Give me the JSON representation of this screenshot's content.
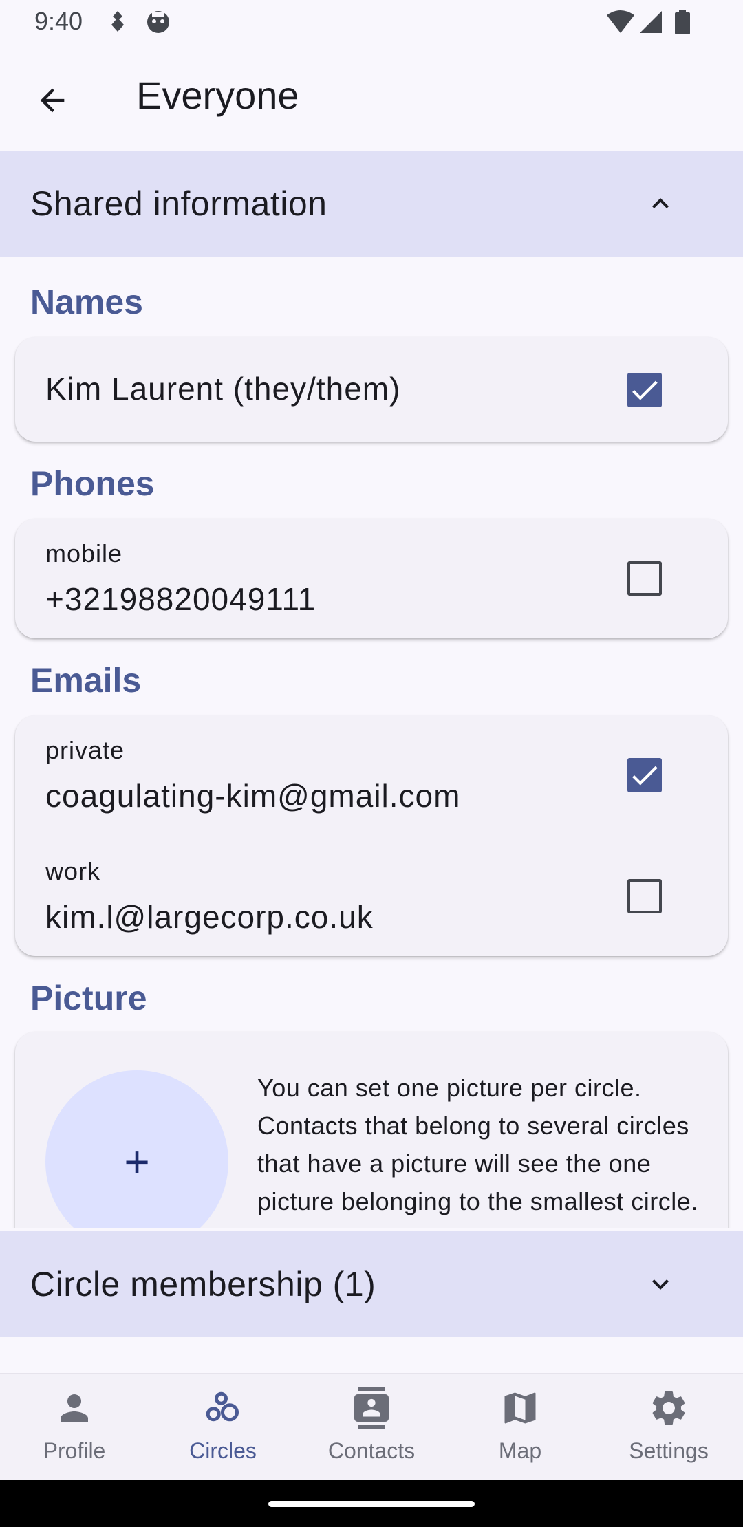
{
  "status": {
    "time": "9:40"
  },
  "app_bar": {
    "title": "Everyone"
  },
  "shared_section": {
    "label": "Shared information"
  },
  "names": {
    "title": "Names",
    "items": [
      {
        "value": "Kim Laurent (they/them)",
        "checked": true
      }
    ]
  },
  "phones": {
    "title": "Phones",
    "items": [
      {
        "label": "mobile",
        "value": "+32198820049111",
        "checked": false
      }
    ]
  },
  "emails": {
    "title": "Emails",
    "items": [
      {
        "label": "private",
        "value": "coagulating-kim@gmail.com",
        "checked": true
      },
      {
        "label": "work",
        "value": "kim.l@largecorp.co.uk",
        "checked": false
      }
    ]
  },
  "picture": {
    "title": "Picture",
    "add_symbol": "+",
    "description": "You can set one picture per circle. Contacts that belong to several circles that have a picture will see the one picture belonging to the smallest circle."
  },
  "membership_section": {
    "label": "Circle membership (1)"
  },
  "nav": {
    "items": [
      {
        "label": "Profile",
        "icon": "person-icon",
        "active": false
      },
      {
        "label": "Circles",
        "icon": "circles-icon",
        "active": true
      },
      {
        "label": "Contacts",
        "icon": "contacts-icon",
        "active": false
      },
      {
        "label": "Map",
        "icon": "map-icon",
        "active": false
      },
      {
        "label": "Settings",
        "icon": "gear-icon",
        "active": false
      }
    ]
  },
  "colors": {
    "accent": "#4a5a94",
    "header_bg": "#e0e0f6",
    "card_bg": "#f3f1f8",
    "avatar_bg": "#dde1ff"
  }
}
